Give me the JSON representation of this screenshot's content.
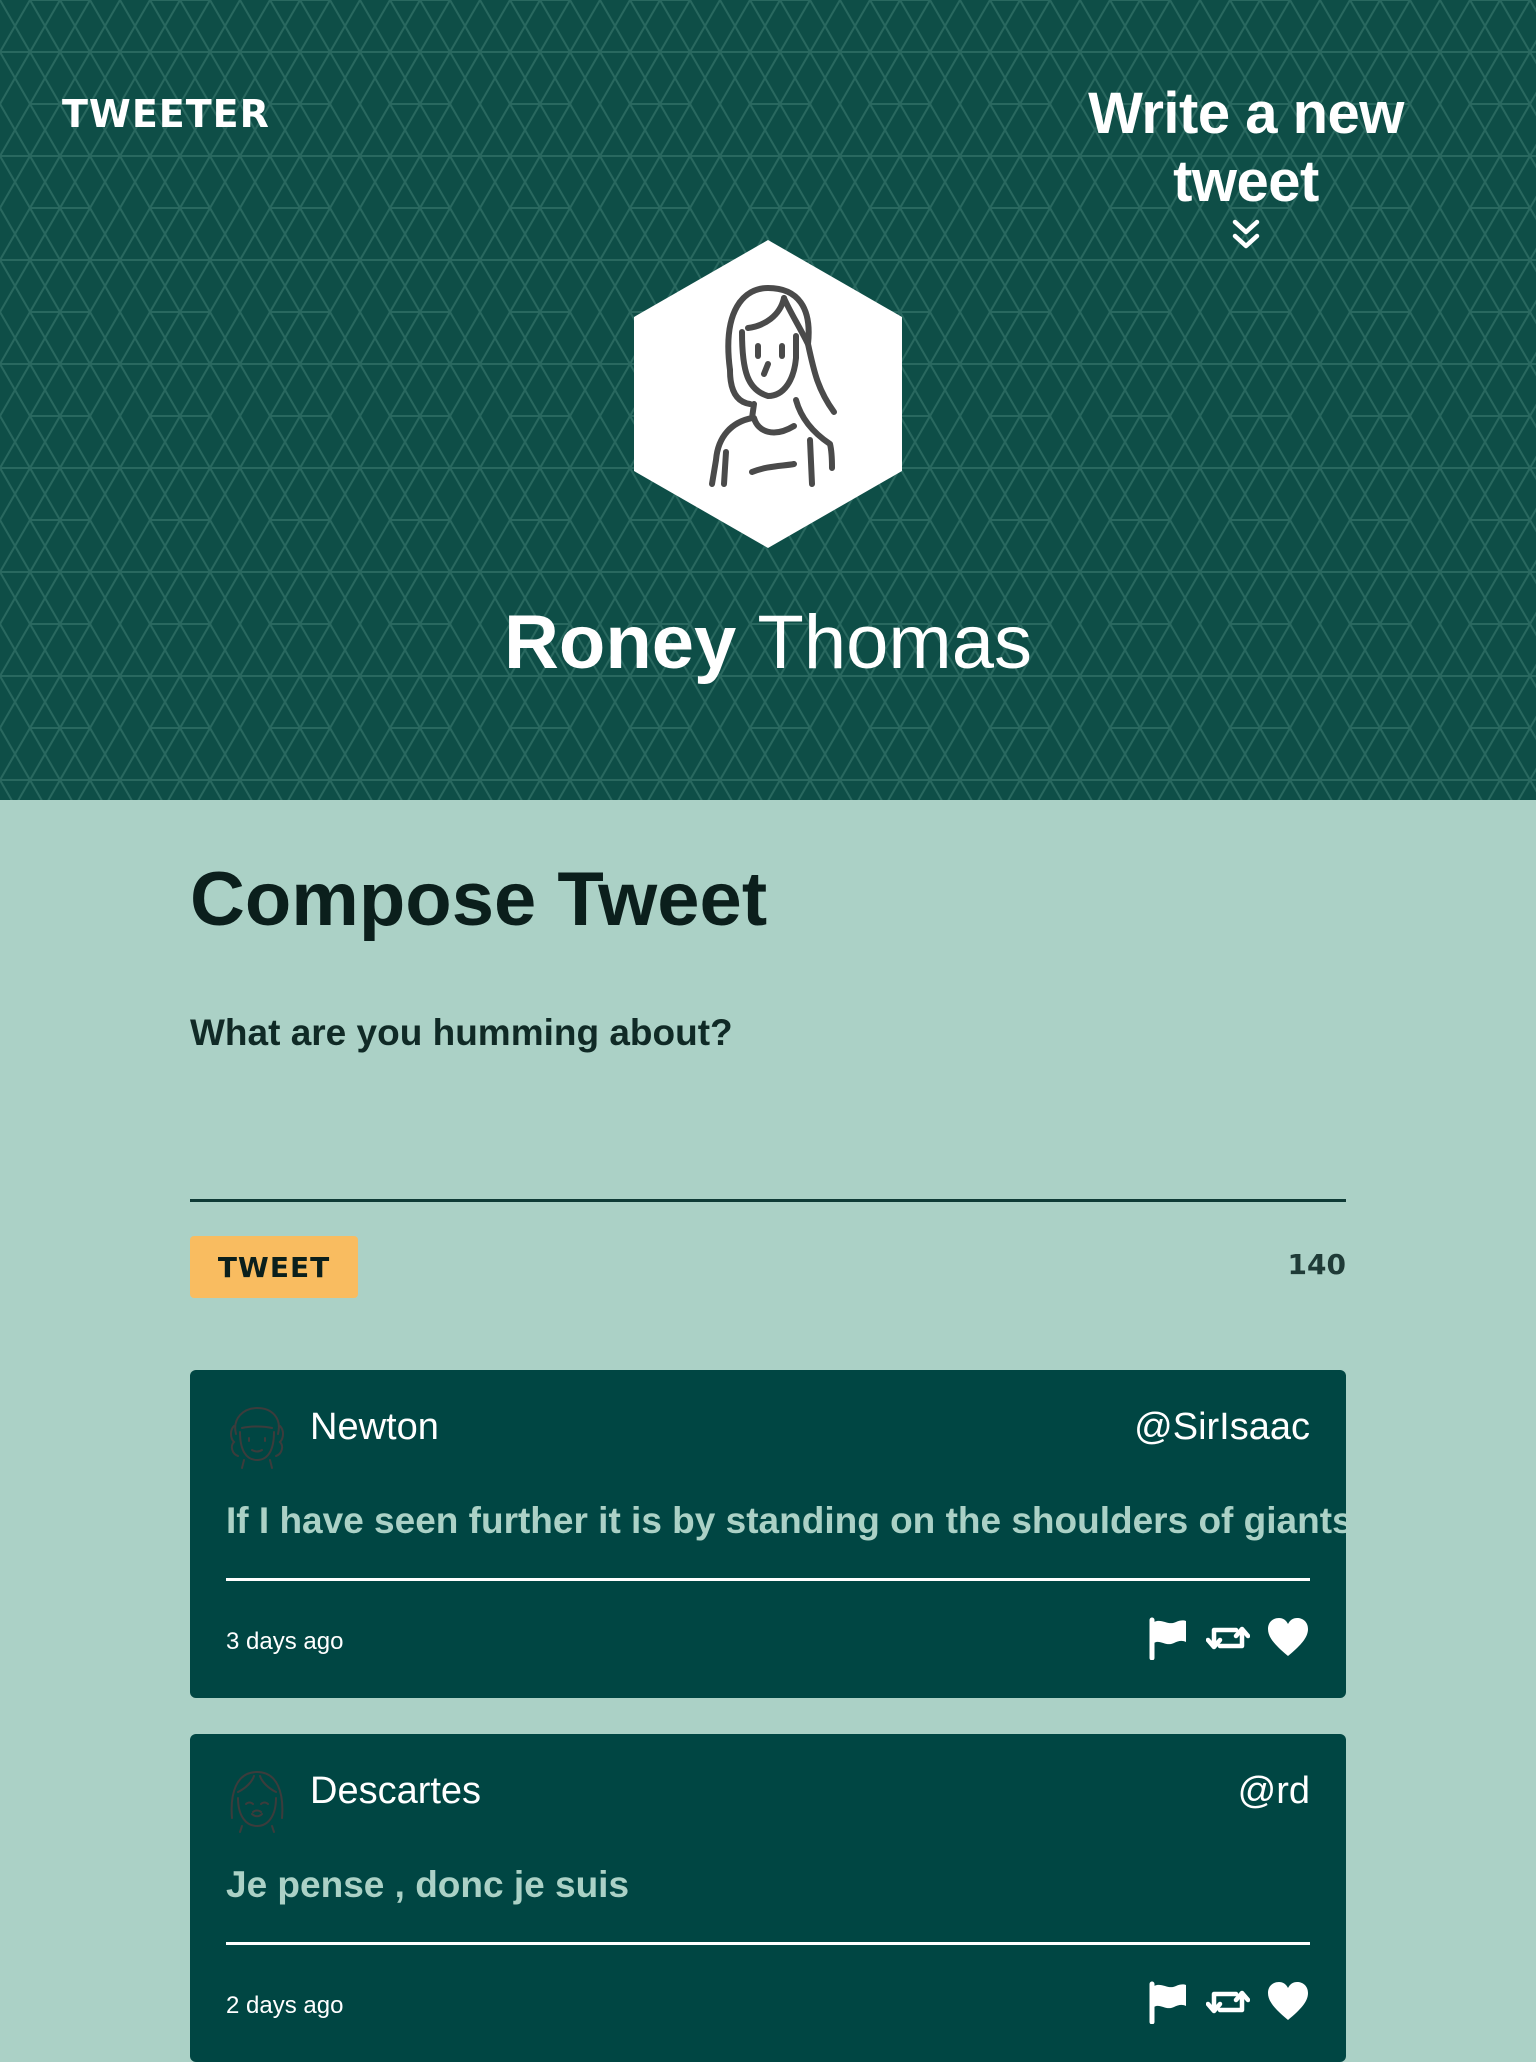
{
  "header": {
    "brand": "TWEETER",
    "write_new_label": "Write a new tweet",
    "profile": {
      "first_name": "Roney",
      "last_name": "Thomas",
      "avatar_icon": "woman-avatar-icon"
    },
    "background_color": "#0e4e47"
  },
  "compose": {
    "title": "Compose Tweet",
    "label": "What are you humming about?",
    "value": "",
    "button_label": "TWEET",
    "counter": "140"
  },
  "tweets": [
    {
      "name": "Newton",
      "handle": "@SirIsaac",
      "text": "If I have seen further it is by standing on the shoulders of giants",
      "time": "3 days ago",
      "avatar_icon": "newton-avatar-icon",
      "actions": [
        "flag-icon",
        "retweet-icon",
        "heart-icon"
      ]
    },
    {
      "name": "Descartes",
      "handle": "@rd",
      "text": "Je pense , donc je suis",
      "time": "2 days ago",
      "avatar_icon": "descartes-avatar-icon",
      "actions": [
        "flag-icon",
        "retweet-icon",
        "heart-icon"
      ]
    }
  ],
  "colors": {
    "page_background": "#abd1c6",
    "tweet_background": "#004643",
    "accent": "#f9bc60",
    "tweet_text": "#abd1c6"
  }
}
